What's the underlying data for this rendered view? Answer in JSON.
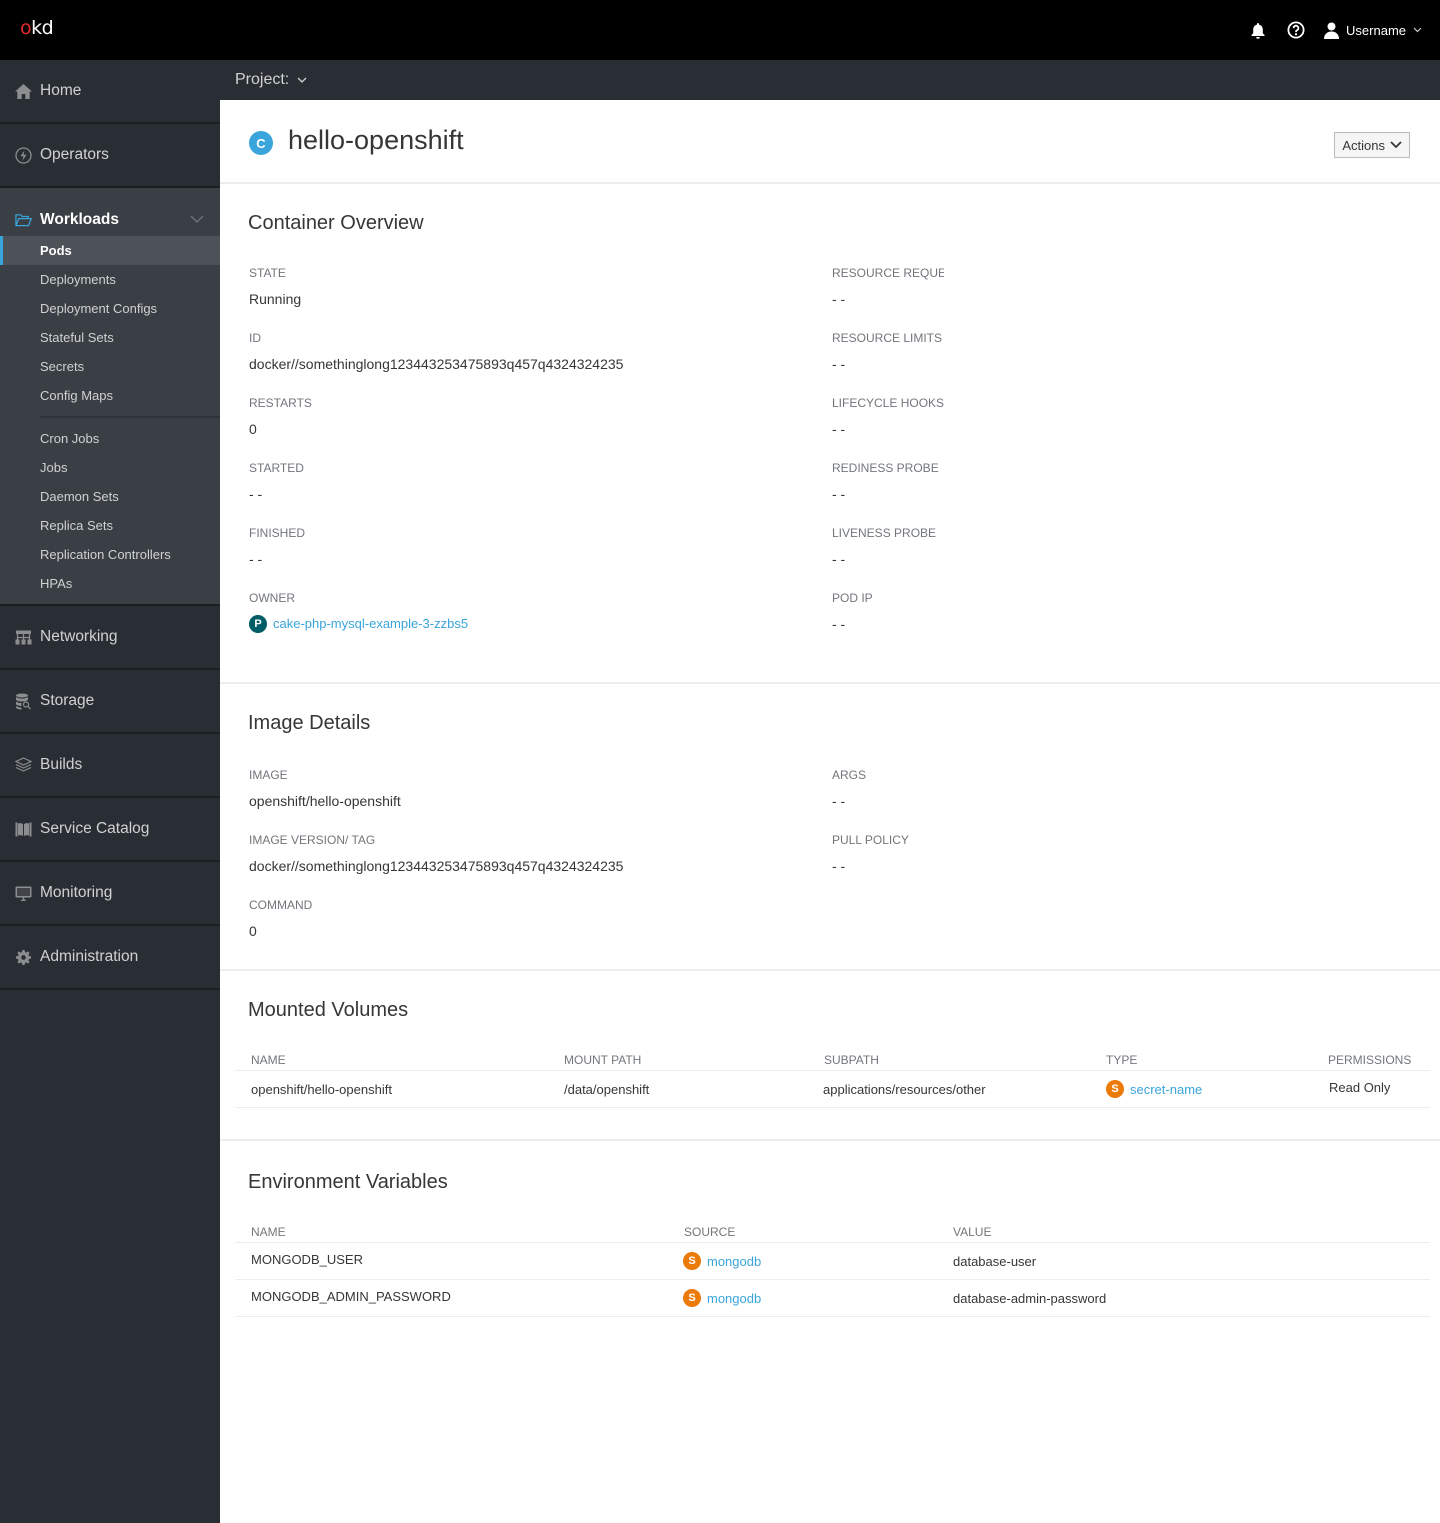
{
  "masthead": {
    "logo_o": "o",
    "logo_rest": "kd",
    "username": "Username",
    "icons": [
      "bell-icon",
      "help-icon",
      "user-icon"
    ]
  },
  "sidebar": {
    "items_top": [
      {
        "label": "Home",
        "icon": "home-icon"
      },
      {
        "label": "Operators",
        "icon": "bolt-icon"
      }
    ],
    "workloads": {
      "label": "Workloads",
      "icon": "folder-open-icon",
      "items": [
        {
          "label": "Pods",
          "active": true
        },
        {
          "label": "Deployments"
        },
        {
          "label": "Deployment Configs"
        },
        {
          "label": "Stateful Sets"
        },
        {
          "label": "Secrets"
        },
        {
          "label": "Config Maps"
        }
      ],
      "items_after_divider": [
        {
          "label": "Cron Jobs"
        },
        {
          "label": "Jobs"
        },
        {
          "label": "Daemon Sets"
        },
        {
          "label": "Replica Sets"
        },
        {
          "label": "Replication Controllers"
        },
        {
          "label": "HPAs"
        }
      ]
    },
    "items_bottom": [
      {
        "label": "Networking",
        "icon": "network-icon"
      },
      {
        "label": "Storage",
        "icon": "storage-icon"
      },
      {
        "label": "Builds",
        "icon": "builds-icon"
      },
      {
        "label": "Service Catalog",
        "icon": "catalog-icon"
      },
      {
        "label": "Monitoring",
        "icon": "monitor-icon"
      },
      {
        "label": "Administration",
        "icon": "gear-icon"
      }
    ]
  },
  "projectbar": {
    "label": "Project:"
  },
  "header": {
    "badge": "C",
    "badge_color": "#39a5dc",
    "title": "hello-openshift",
    "actions_label": "Actions"
  },
  "container_overview": {
    "title": "Container Overview",
    "left": [
      {
        "term": "State",
        "desc": "Running"
      },
      {
        "term": "ID",
        "desc": "docker//somethinglong123443253475893q457q4324324235"
      },
      {
        "term": "Restarts",
        "desc": "0"
      },
      {
        "term": "Started",
        "desc": "- -"
      },
      {
        "term": "Finished",
        "desc": "- -"
      },
      {
        "term": "Owner",
        "badge": "P",
        "badge_color": "#005c66",
        "link": "cake-php-mysql-example-3-zzbs5"
      }
    ],
    "right": [
      {
        "term": "Resource Requests",
        "desc": "- -"
      },
      {
        "term": "Resource Limits",
        "desc": "- -"
      },
      {
        "term": "Lifecycle Hooks",
        "desc": "- -"
      },
      {
        "term": "Rediness Probe",
        "desc": "- -"
      },
      {
        "term": "Liveness Probe",
        "desc": "- -"
      },
      {
        "term": "Pod IP",
        "desc": "- -"
      }
    ]
  },
  "image_details": {
    "title": "Image Details",
    "left": [
      {
        "term": "Image",
        "desc": "openshift/hello-openshift"
      },
      {
        "term": "Image Version/ Tag",
        "desc": "docker//somethinglong123443253475893q457q4324324235"
      },
      {
        "term": "Command",
        "desc": "0"
      }
    ],
    "right": [
      {
        "term": "Args",
        "desc": "- -"
      },
      {
        "term": "Pull Policy",
        "desc": "- -"
      }
    ]
  },
  "mounted_volumes": {
    "title": "Mounted Volumes",
    "columns": [
      "Name",
      "Mount Path",
      "Subpath",
      "Type",
      "Permissions"
    ],
    "rows": [
      {
        "name": "openshift/hello-openshift",
        "mount_path": "/data/openshift",
        "subpath": "applications/resources/other",
        "type_badge": "S",
        "type_link": "secret-name",
        "permissions": "Read Only"
      }
    ]
  },
  "env_vars": {
    "title": "Environment Variables",
    "columns": [
      "Name",
      "Source",
      "Value"
    ],
    "rows": [
      {
        "name": "MONGODB_USER",
        "source_badge": "S",
        "source_link": "mongodb",
        "value": "database-user"
      },
      {
        "name": "MONGODB_ADMIN_PASSWORD",
        "source_badge": "S",
        "source_link": "mongodb",
        "value": "database-admin-password"
      }
    ]
  },
  "colors": {
    "secret_badge": "#ec7a08",
    "link": "#39a5dc",
    "active_accent": "#39a5dc"
  }
}
